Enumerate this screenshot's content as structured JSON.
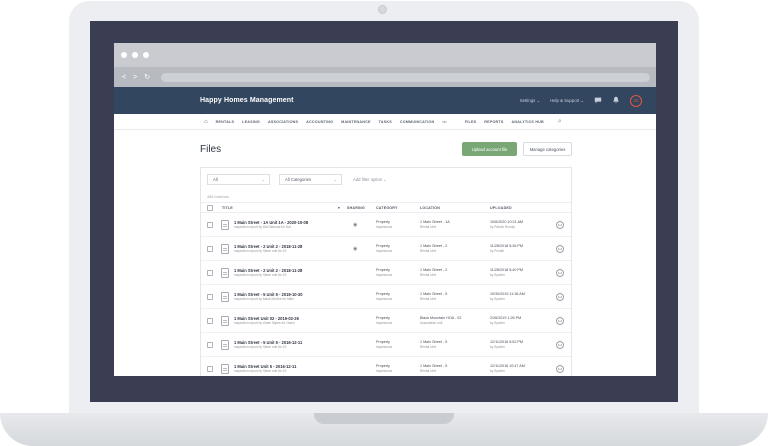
{
  "app": {
    "company": "Happy Homes Management",
    "settings": "Settings ⌄",
    "help": "Help & Support ⌄",
    "avatar": "JG"
  },
  "nav": {
    "items": [
      "RENTALS",
      "LEASING",
      "ASSOCIATIONS",
      "ACCOUNTING",
      "MAINTENANCE",
      "TASKS",
      "COMMUNICATION",
      "•••",
      "FILES",
      "REPORTS",
      "ANALYTICS HUB"
    ]
  },
  "page": {
    "title": "Files",
    "upload_label": "Upload account file",
    "manage_label": "Manage categories"
  },
  "filters": {
    "all": "All",
    "categories": "All Categories",
    "add_filter": "Add filter option ⌄",
    "results": "456 matches"
  },
  "table": {
    "headers": {
      "title": "TITLE",
      "sharing": "SHARING",
      "category": "CATEGORY",
      "location": "LOCATION",
      "uploaded": "UPLOADED"
    },
    "rows": [
      {
        "title": "1 Main Street - 1A Unit 1A - 2020-10-08",
        "sub": "Inspection report by Dal Sabrosa for Dal",
        "shared": true,
        "cat1": "Property",
        "cat2": "Inspections",
        "loc1": "1 Main Street - 1A",
        "loc2": "Rental Unit",
        "up1": "10/6/2020 10:21 AM",
        "up2": "by Patrick Rourky"
      },
      {
        "title": "1 Main Street - 2 Unit 2 - 2018-11-28",
        "sub": "Inspection report by Steve unit for 1S",
        "shared": true,
        "cat1": "Property",
        "cat2": "Inspections",
        "loc1": "1 Main Street - 2",
        "loc2": "Rental Unit",
        "up1": "11/28/2018 5:36 PM",
        "up2": "by Prositt!"
      },
      {
        "title": "1 Main Street - 2 Unit 2 - 2018-11-28",
        "sub": "Inspection report by Steve unit for 1S",
        "shared": false,
        "cat1": "Property",
        "cat2": "Inspections",
        "loc1": "1 Main Street - 2",
        "loc2": "Rental Unit",
        "up1": "11/28/2018 5:40 PM",
        "up2": "by System"
      },
      {
        "title": "1 Main Street - 5 Unit 5 - 2019-10-30",
        "sub": "Inspection report by Mack McGee for Mike",
        "shared": false,
        "cat1": "Property",
        "cat2": "Inspections",
        "loc1": "1 Main Street - 5",
        "loc2": "Rental Unit",
        "up1": "10/30/2019 11:36 AM",
        "up2": "by System"
      },
      {
        "title": "1 Main Street Unit 02 - 2019-02-26",
        "sub": "Inspection report by Owen Myers for Owen",
        "shared": false,
        "cat1": "Property",
        "cat2": "Inspections",
        "loc1": "Black Mountain HOA - 02",
        "loc2": "Association unit",
        "up1": "2/26/2019 1:26 PM",
        "up2": "by System"
      },
      {
        "title": "1 Main Street - 5 Unit 5 - 2016-12-11",
        "sub": "Inspection report by Steve unit for 1S",
        "shared": false,
        "cat1": "Property",
        "cat2": "Inspections",
        "loc1": "1 Main Street - 5",
        "loc2": "Rental Unit",
        "up1": "12/11/2016 5:52 PM",
        "up2": "by System"
      },
      {
        "title": "1 Main Street Unit 5 - 2016-12-11",
        "sub": "Inspection report by Steve unit for 1S",
        "shared": false,
        "cat1": "Property",
        "cat2": "Inspections",
        "loc1": "1 Main Street - 5",
        "loc2": "Rental Unit",
        "up1": "12/11/2016 10:47 AM",
        "up2": "by System"
      }
    ]
  },
  "colors": {
    "header_bg": "#33465f",
    "accent_green": "#79a876",
    "bezel": "#3b3e52"
  }
}
